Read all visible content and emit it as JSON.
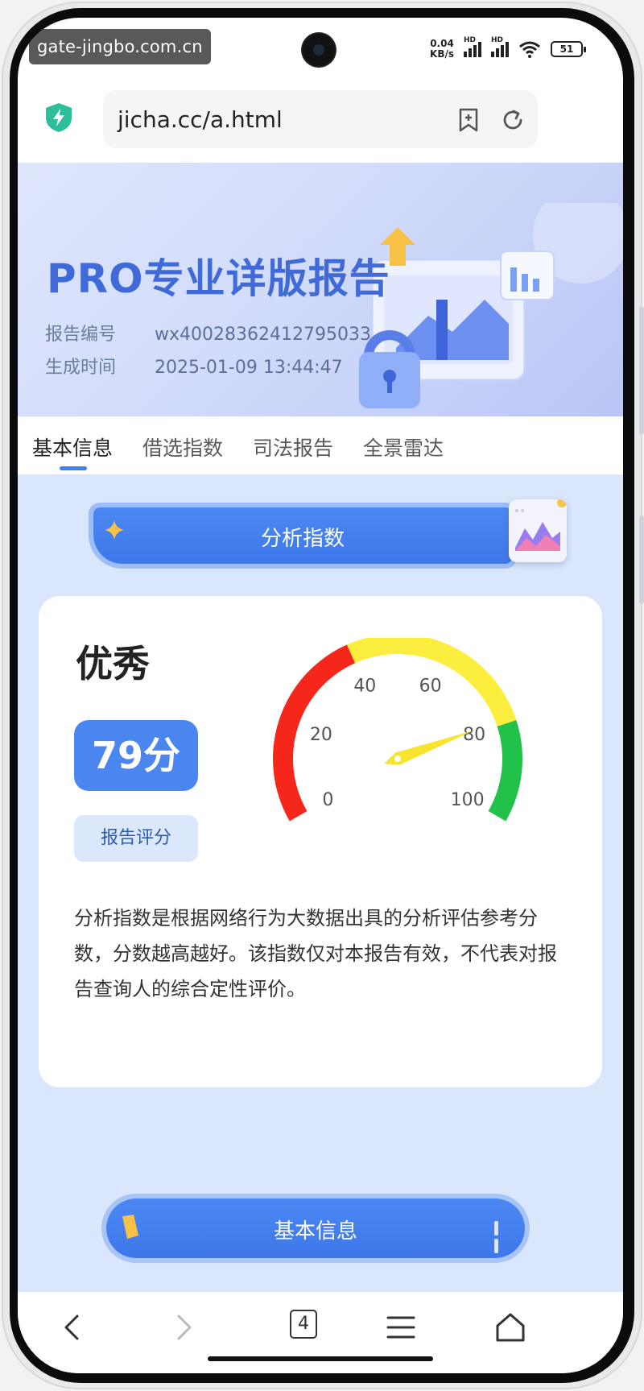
{
  "status_bar": {
    "watermark": "gate-jingbo.com.cn",
    "net_speed_value": "0.04",
    "net_speed_unit": "KB/s",
    "signal_label": "HD",
    "battery": "51"
  },
  "browser": {
    "url": "jicha.cc/a.html",
    "tab_count": "4"
  },
  "hero": {
    "title": "PRO专业详版报告",
    "report_id_label": "报告编号",
    "report_id": "wx40028362412795033",
    "generated_label": "生成时间",
    "generated_time": "2025-01-09 13:44:47"
  },
  "tabs": [
    "基本信息",
    "借选指数",
    "司法报告",
    "全景雷达"
  ],
  "analysis": {
    "section_title": "分析指数",
    "rating": "优秀",
    "score_text": "79分",
    "report_score_button": "报告评分",
    "description": "分析指数是根据网络行为大数据出具的分析评估参考分数，分数越高越好。该指数仅对本报告有效，不代表对报告查询人的综合定性评价。"
  },
  "gauge": {
    "value": 79,
    "min": 0,
    "max": 100,
    "tick_labels": [
      "0",
      "20",
      "40",
      "60",
      "80",
      "100"
    ],
    "bands": [
      {
        "from": 0,
        "to": 40,
        "color": "#f5271b"
      },
      {
        "from": 40,
        "to": 80,
        "color": "#fbee3e"
      },
      {
        "from": 80,
        "to": 100,
        "color": "#22c24a"
      }
    ],
    "needle_color": "#f8e42c"
  },
  "next_section": {
    "title": "基本信息"
  },
  "colors": {
    "accent": "#3b82f6",
    "hero_title": "#3f6ad8"
  }
}
